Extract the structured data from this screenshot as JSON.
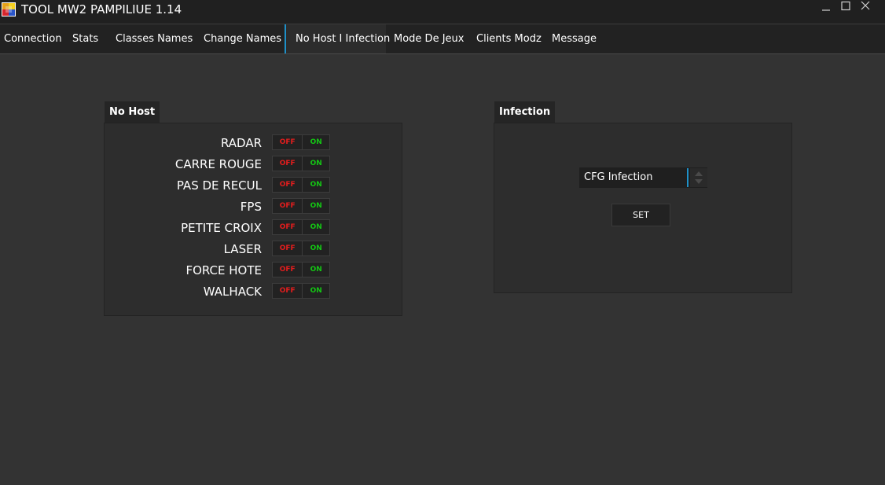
{
  "window": {
    "title": "TOOL MW2 PAMPILIUE 1.14",
    "icon": "app-tile-icon",
    "controls": [
      "minimize-icon",
      "maximize-icon",
      "close-icon"
    ]
  },
  "menu": {
    "tabs": [
      {
        "label": "Connection"
      },
      {
        "label": "Stats"
      },
      {
        "label": "Classes Names"
      },
      {
        "label": "Change Names"
      },
      {
        "label": "No Host I Infection",
        "active": true
      },
      {
        "label": "Mode De Jeux"
      },
      {
        "label": "Clients Modz"
      },
      {
        "label": "Message"
      }
    ]
  },
  "no_host": {
    "title": "No Host",
    "off_label": "OFF",
    "on_label": "ON",
    "options": [
      {
        "label": "RADAR"
      },
      {
        "label": "CARRE ROUGE"
      },
      {
        "label": "PAS DE RECUL"
      },
      {
        "label": "FPS"
      },
      {
        "label": "PETITE CROIX"
      },
      {
        "label": "LASER"
      },
      {
        "label": "FORCE HOTE"
      },
      {
        "label": "WALHACK"
      }
    ]
  },
  "infection": {
    "title": "Infection",
    "select_value": "CFG Infection",
    "set_label": "SET"
  },
  "colors": {
    "background": "#333333",
    "off": "#e51d1d",
    "on": "#14c714",
    "accent": "#1e90c8"
  }
}
